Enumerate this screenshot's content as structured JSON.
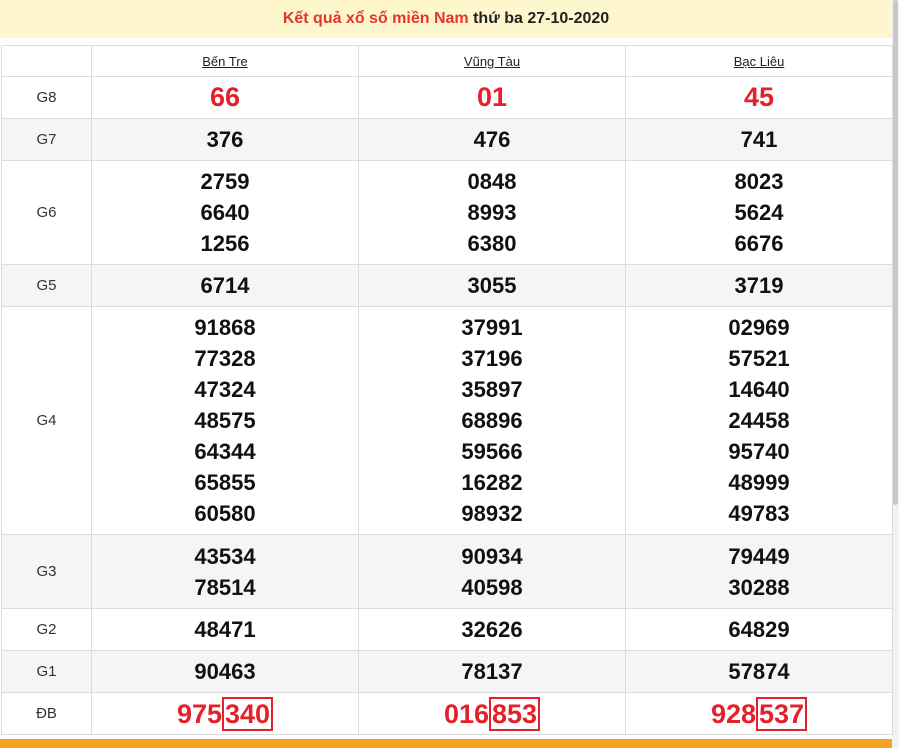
{
  "header": {
    "title_red": "Kết quả xổ số miền Nam",
    "title_dark": "thứ ba 27-10-2020"
  },
  "provinces": [
    "Bến Tre",
    "Vũng Tàu",
    "Bạc Liêu"
  ],
  "prizes": [
    {
      "label": "G8",
      "values": [
        [
          "66"
        ],
        [
          "01"
        ],
        [
          "45"
        ]
      ]
    },
    {
      "label": "G7",
      "values": [
        [
          "376"
        ],
        [
          "476"
        ],
        [
          "741"
        ]
      ]
    },
    {
      "label": "G6",
      "values": [
        [
          "2759",
          "6640",
          "1256"
        ],
        [
          "0848",
          "8993",
          "6380"
        ],
        [
          "8023",
          "5624",
          "6676"
        ]
      ]
    },
    {
      "label": "G5",
      "values": [
        [
          "6714"
        ],
        [
          "3055"
        ],
        [
          "3719"
        ]
      ]
    },
    {
      "label": "G4",
      "values": [
        [
          "91868",
          "77328",
          "47324",
          "48575",
          "64344",
          "65855",
          "60580"
        ],
        [
          "37991",
          "37196",
          "35897",
          "68896",
          "59566",
          "16282",
          "98932"
        ],
        [
          "02969",
          "57521",
          "14640",
          "24458",
          "95740",
          "48999",
          "49783"
        ]
      ]
    },
    {
      "label": "G3",
      "values": [
        [
          "43534",
          "78514"
        ],
        [
          "90934",
          "40598"
        ],
        [
          "79449",
          "30288"
        ]
      ]
    },
    {
      "label": "G2",
      "values": [
        [
          "48471"
        ],
        [
          "32626"
        ],
        [
          "64829"
        ]
      ]
    },
    {
      "label": "G1",
      "values": [
        [
          "90463"
        ],
        [
          "78137"
        ],
        [
          "57874"
        ]
      ]
    }
  ],
  "special": {
    "label": "ĐB",
    "values": [
      {
        "head": "975",
        "tail": "340"
      },
      {
        "head": "016",
        "tail": "853"
      },
      {
        "head": "928",
        "tail": "537"
      }
    ]
  },
  "colors": {
    "accent_red": "#e4202a",
    "header_bg": "#fef7cd",
    "bottom_bar": "#f5a323"
  }
}
